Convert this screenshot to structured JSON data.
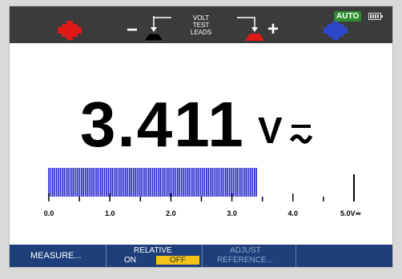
{
  "topbar": {
    "lead_label_lines": [
      "VOLT",
      "TEST",
      "LEADS"
    ],
    "minus_sign": "−",
    "plus_sign": "+",
    "auto_badge": "AUTO",
    "colors": {
      "red_jack": "#e01818",
      "blue_jack": "#2c47c9",
      "black_lead": "#000000",
      "auto_bg": "#2e8b2e"
    }
  },
  "reading": {
    "value": "3.411",
    "unit": "V",
    "mode_icon": "ac-dc-icon"
  },
  "bargraph": {
    "fill_fraction": 0.682,
    "tick_labels": [
      "0.0",
      "1.0",
      "2.0",
      "3.0",
      "4.0",
      "5.0V≂"
    ],
    "bar_color": "#2222cc"
  },
  "softkeys": {
    "measure": "MEASURE...",
    "relative_title": "RELATIVE",
    "relative_on": "ON",
    "relative_off": "OFF",
    "adjust_line1": "ADJUST",
    "adjust_line2": "REFERENCE..."
  }
}
